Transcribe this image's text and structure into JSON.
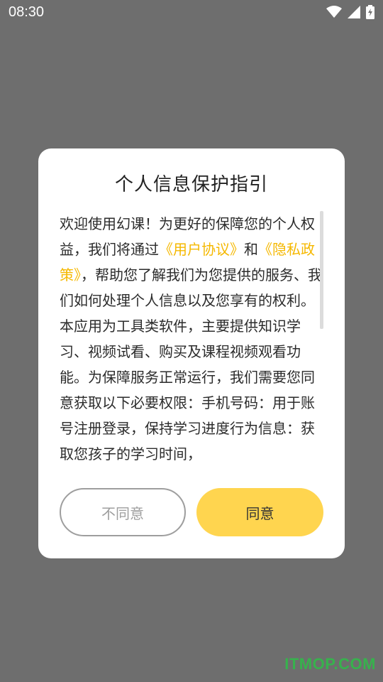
{
  "status_bar": {
    "time": "08:30",
    "icons": [
      "wifi-icon",
      "cell-signal-icon",
      "battery-charging-icon"
    ]
  },
  "dialog": {
    "title": "个人信息保护指引",
    "body": {
      "part1": "欢迎使用幻课！为更好的保障您的个人权益，我们将通过",
      "link_user_agreement": "《用户协议》",
      "part2": "和",
      "link_privacy_policy": "《隐私政策》",
      "part3": "，帮助您了解我们为您提供的服务、我们如何处理个人信息以及您享有的权利。本应用为工具类软件，主要提供知识学习、视频试看、购买及课程视频观看功能。为保障服务正常运行，我们需要您同意获取以下必要权限：手机号码：用于账号注册登录，保持学习进度行为信息：获取您孩子的学习时间，"
    },
    "decline_label": "不同意",
    "agree_label": "同意"
  },
  "watermark": "ITMOP.COM",
  "colors": {
    "overlay": "#6e6e6e",
    "accent": "#ffd54f",
    "link": "#f5b800",
    "decline_border": "#9e9e9e"
  }
}
